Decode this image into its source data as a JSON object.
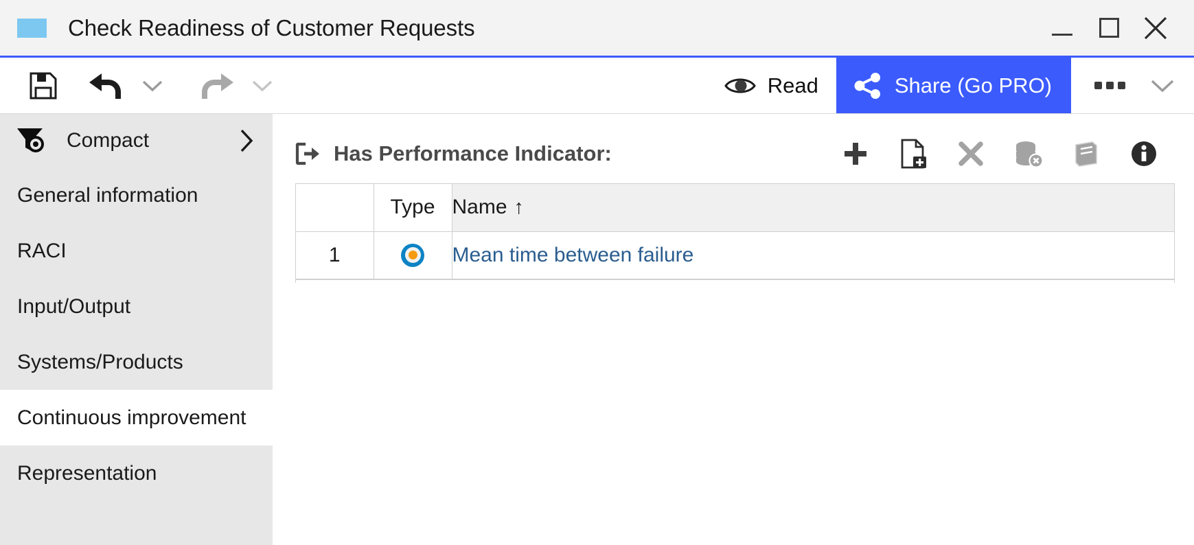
{
  "window": {
    "title": "Check Readiness of Customer Requests",
    "accent_color": "#3b5bfd",
    "swatch_color": "#7dc8f0",
    "controls": {
      "minimize": "minimize",
      "maximize": "maximize",
      "close": "close"
    }
  },
  "toolbar": {
    "save_label": "Save",
    "undo_label": "Undo",
    "undo_menu_label": "Undo options",
    "redo_label": "Redo",
    "redo_menu_label": "Redo options",
    "read_label": "Read",
    "share_label": "Share (Go PRO)",
    "more_label": "More",
    "more_menu_label": "More options"
  },
  "sidebar": {
    "filter": {
      "label": "Compact",
      "expand_label": "Expand"
    },
    "items": [
      {
        "label": "General information",
        "active": false
      },
      {
        "label": "RACI",
        "active": false
      },
      {
        "label": "Input/Output",
        "active": false
      },
      {
        "label": "Systems/Products",
        "active": false
      },
      {
        "label": "Continuous improvement",
        "active": true
      },
      {
        "label": "Representation",
        "active": false
      }
    ]
  },
  "main": {
    "section": {
      "title": "Has Performance Indicator:",
      "actions": [
        {
          "name": "add",
          "label": "Add"
        },
        {
          "name": "new-document",
          "label": "Create new"
        },
        {
          "name": "remove",
          "label": "Remove"
        },
        {
          "name": "clear-data",
          "label": "Clear data"
        },
        {
          "name": "catalog",
          "label": "Catalog"
        },
        {
          "name": "info",
          "label": "Information"
        }
      ]
    },
    "table": {
      "columns": [
        "",
        "Type",
        "Name"
      ],
      "sort_column": "Name",
      "sort_direction": "↑",
      "rows": [
        {
          "index": "1",
          "type_icon": "kpi-indicator-icon",
          "name": "Mean time between failure"
        }
      ]
    }
  }
}
